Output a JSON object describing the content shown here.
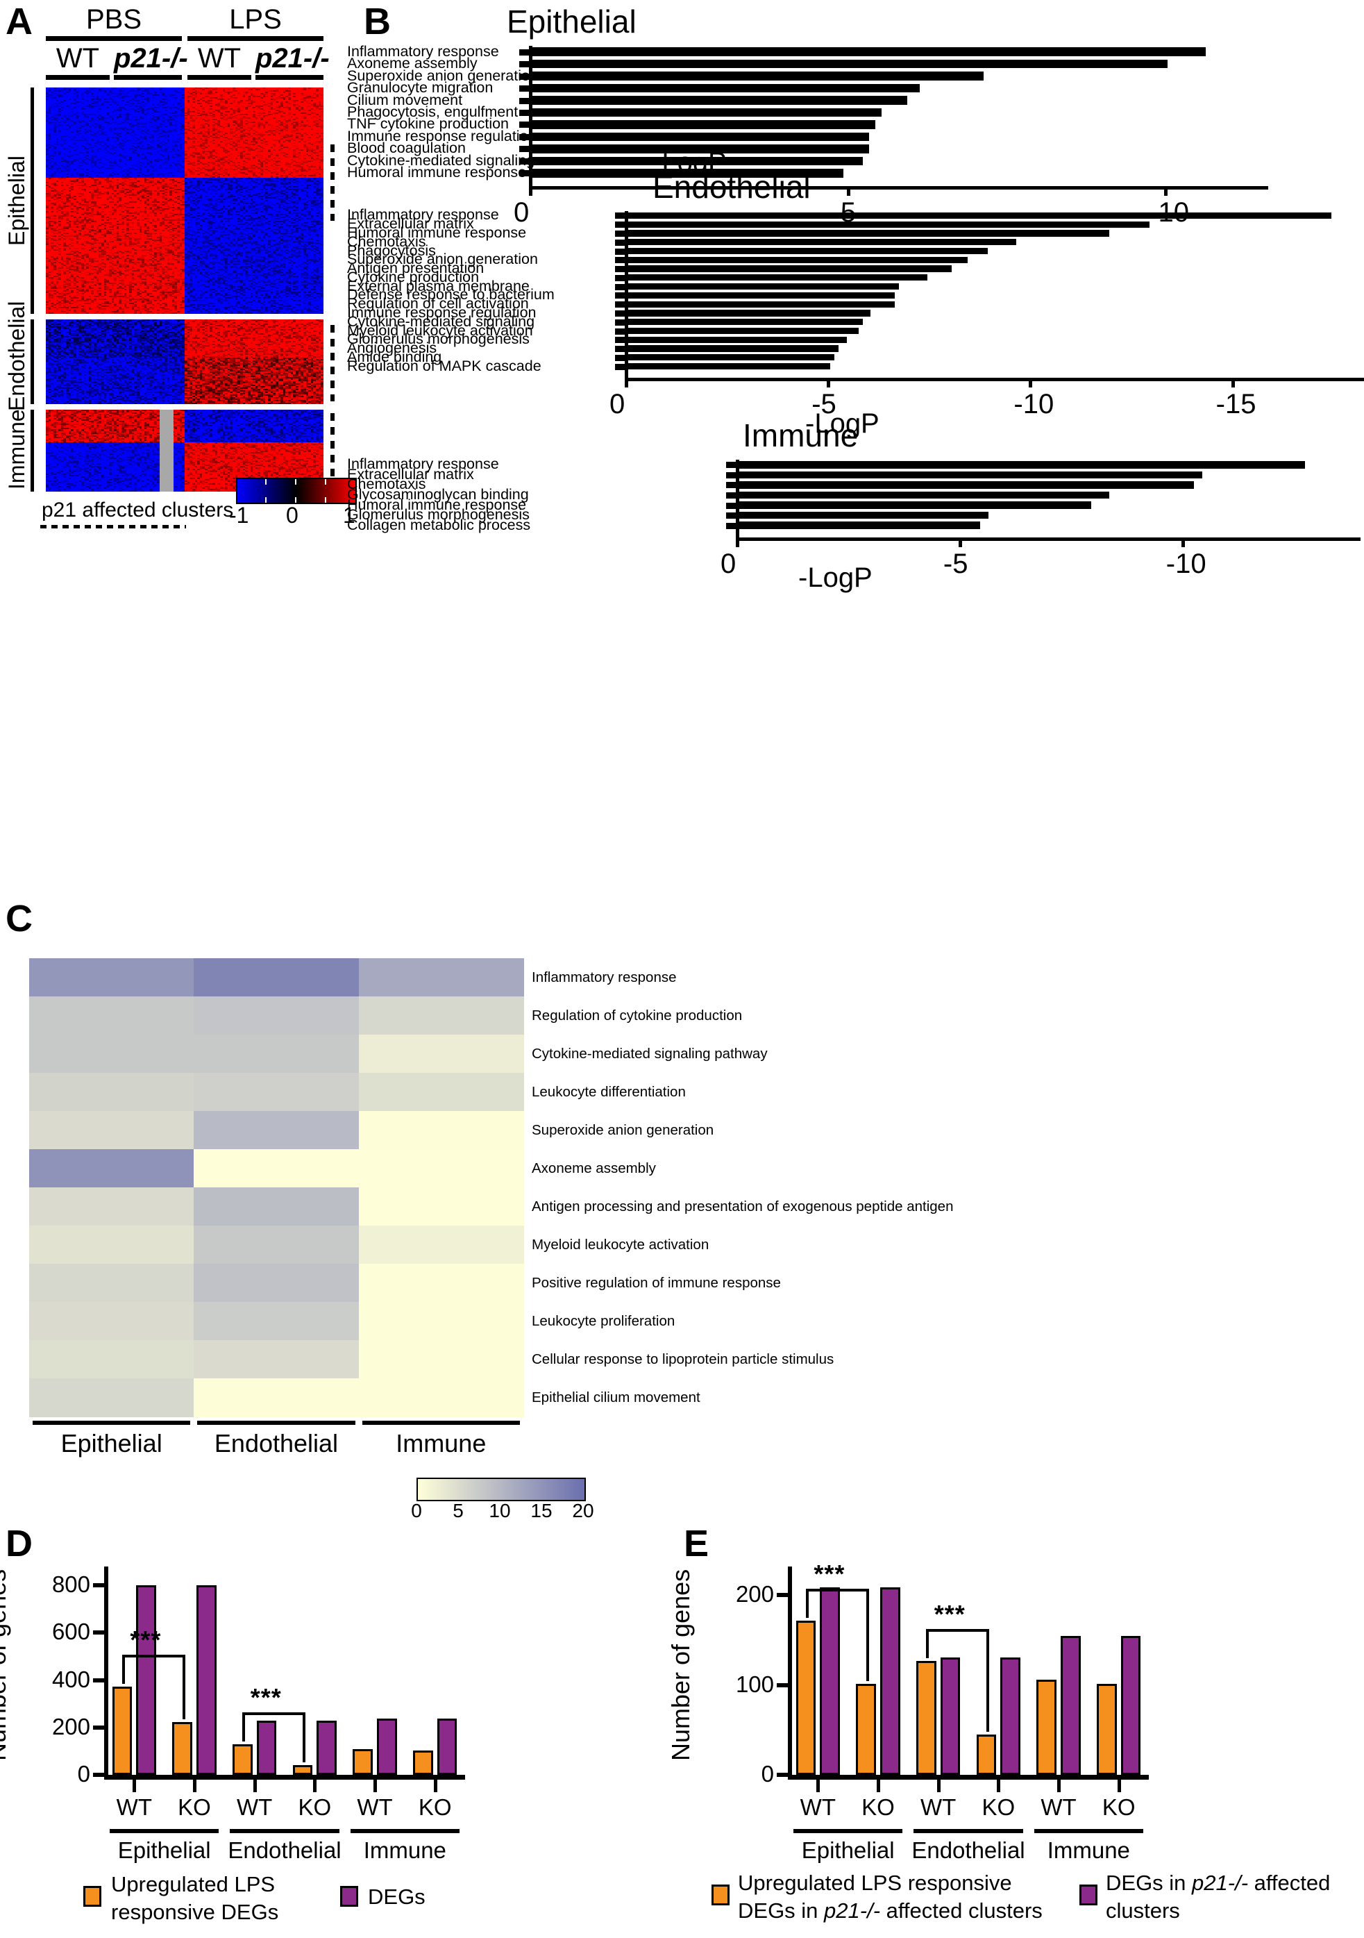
{
  "panels": {
    "A": {
      "letter": "A"
    },
    "B": {
      "letter": "B"
    },
    "C": {
      "letter": "C"
    },
    "D": {
      "letter": "D"
    },
    "E": {
      "letter": "E"
    }
  },
  "panelA": {
    "treatments": [
      "PBS",
      "LPS"
    ],
    "genotypes": [
      "WT",
      "p21-/-",
      "WT",
      "p21-/-"
    ],
    "row_groups": [
      "Epithelial",
      "Endothelial",
      "Immune"
    ],
    "cluster_note": "p21 affected clusters",
    "colorbar": {
      "min": "-1",
      "mid": "0",
      "max": "1",
      "low_color": "#0000FF",
      "mid_color": "#000000",
      "high_color": "#FF0000"
    }
  },
  "chart_data": [
    {
      "type": "bar",
      "title": "Epithelial",
      "xlabel": "-LogP",
      "orientation": "horizontal",
      "xlim": [
        0,
        -11.2
      ],
      "xticks": [
        0,
        -5,
        -10
      ],
      "xticklabels": [
        "0",
        "-5",
        "-10"
      ],
      "categories": [
        "Inflammatory response",
        "Axoneme assembly",
        "Superoxide anion generation",
        "Granulocyte migration",
        "Cilium movement",
        "Phagocytosis, engulfment",
        "TNF cytokine production",
        "Immune response regulation",
        "Blood coagulation",
        "Cytokine-mediated signaling",
        "Humoral immune response"
      ],
      "values": [
        -10.6,
        -10.0,
        -7.1,
        -6.1,
        -5.9,
        -5.5,
        -5.4,
        -5.3,
        -5.3,
        -5.2,
        -4.9
      ]
    },
    {
      "type": "bar",
      "title": "Endothelial",
      "xlabel": "-LogP",
      "orientation": "horizontal",
      "xlim": [
        0,
        -18.2
      ],
      "xticks": [
        0,
        -5,
        -10,
        -15
      ],
      "xticklabels": [
        "0",
        "-5",
        "-10",
        "-15"
      ],
      "categories": [
        "Inflammatory response",
        "Extracellular matrix",
        "Humoral immune response",
        "Chemotaxis",
        "Phagocytosis",
        "Superoxide anion generation",
        "Antigen presentation",
        "Cytokine production",
        "External plasma membrane",
        "Defense response to bacterium",
        "Regulation of cell activation",
        "Immune response regulation",
        "Cytokine-mediated signaling",
        "Myeloid leukocyte activation",
        "Glomerulus morphogenesis",
        "Angiogenesis",
        "Amide binding",
        "Regulation of MAPK cascade"
      ],
      "values": [
        -17.4,
        -12.9,
        -11.9,
        -9.6,
        -8.9,
        -8.4,
        -8.0,
        -7.4,
        -6.7,
        -6.6,
        -6.6,
        -6.0,
        -5.8,
        -5.7,
        -5.4,
        -5.2,
        -5.1,
        -5.0
      ]
    },
    {
      "type": "bar",
      "title": "Immune",
      "xlabel": "-LogP",
      "orientation": "horizontal",
      "xlim": [
        0,
        -13.4
      ],
      "xticks": [
        0,
        -5,
        -10
      ],
      "xticklabels": [
        "0",
        "-5",
        "-10"
      ],
      "categories": [
        "Inflammatory response",
        "Extracellular matrix",
        "Chemotaxis",
        "Glycosaminoglycan binding",
        "Humoral immune response",
        "Glomerulus morphogenesis",
        "Collagen metabolic process"
      ],
      "values": [
        -12.7,
        -10.4,
        -10.2,
        -8.3,
        -7.9,
        -5.6,
        -5.4
      ]
    },
    {
      "type": "heatmap",
      "title": "",
      "columns": [
        "Epithelial",
        "Endothelial",
        "Immune"
      ],
      "rows": [
        "Inflammatory response",
        "Regulation of cytokine production",
        "Cytokine-mediated signaling pathway",
        "Leukocyte differentiation",
        "Superoxide anion generation",
        "Axoneme assembly",
        "Antigen processing and presentation of exogenous peptide antigen",
        "Myeloid leukocyte activation",
        "Positive regulation of immune response",
        "Leukocyte proliferation",
        "Cellular response to lipoprotein particle stimulus",
        "Epithelial cilium movement"
      ],
      "values": [
        [
          14.5,
          17.0,
          12.0
        ],
        [
          7.5,
          8.0,
          5.5
        ],
        [
          7.5,
          7.5,
          2.5
        ],
        [
          6.0,
          6.5,
          4.5
        ],
        [
          5.0,
          9.5,
          0.3
        ],
        [
          15.0,
          0.2,
          0.2
        ],
        [
          5.0,
          9.0,
          0.2
        ],
        [
          4.0,
          7.5,
          2.0
        ],
        [
          5.5,
          8.5,
          0.3
        ],
        [
          5.0,
          7.0,
          0.3
        ],
        [
          4.5,
          5.0,
          0.3
        ],
        [
          5.5,
          0.3,
          0.3
        ]
      ],
      "colorbar": {
        "ticks": [
          "0",
          "5",
          "10",
          "15",
          "20"
        ],
        "low_color": "#FFFFD9",
        "high_color": "#6A6FAE"
      }
    },
    {
      "type": "bar",
      "panel": "D",
      "ylabel": "Number of genes",
      "ylim": [
        0,
        880
      ],
      "yticks": [
        0,
        200,
        400,
        600,
        800
      ],
      "yticklabels": [
        "0",
        "200",
        "400",
        "600",
        "800"
      ],
      "groups": [
        "Epithelial",
        "Endothelial",
        "Immune"
      ],
      "categories": [
        "WT",
        "KO",
        "WT",
        "KO",
        "WT",
        "KO"
      ],
      "series": [
        {
          "name": "Upregulated LPS responsive DEGs",
          "color": "#F5901E",
          "values": [
            373,
            222,
            128,
            42,
            108,
            103
          ]
        },
        {
          "name": "DEGs",
          "color": "#8B2A8B",
          "values": [
            800,
            800,
            228,
            228,
            238,
            238
          ]
        }
      ],
      "significance": [
        "***",
        "***"
      ],
      "legend": [
        {
          "label": "Upregulated LPS responsive DEGs",
          "color": "#F5901E"
        },
        {
          "label": "DEGs",
          "color": "#8B2A8B"
        }
      ]
    },
    {
      "type": "bar",
      "panel": "E",
      "ylabel": "Number of genes",
      "ylim": [
        0,
        232
      ],
      "yticks": [
        0,
        100,
        200
      ],
      "yticklabels": [
        "0",
        "100",
        "200"
      ],
      "groups": [
        "Epithelial",
        "Endothelial",
        "Immune"
      ],
      "categories": [
        "WT",
        "KO",
        "WT",
        "KO",
        "WT",
        "KO"
      ],
      "series": [
        {
          "name": "Upregulated LPS responsive DEGs in p21-/- affected clusters",
          "color": "#F5901E",
          "values": [
            172,
            101,
            127,
            45,
            106,
            101
          ]
        },
        {
          "name": "DEGs in p21-/- affected clusters",
          "color": "#8B2A8B",
          "values": [
            209,
            209,
            131,
            131,
            155,
            155
          ]
        }
      ],
      "significance": [
        "***",
        "***"
      ],
      "legend": [
        {
          "label_line1": "Upregulated LPS responsive",
          "label_line2_pre": "DEGs in ",
          "label_line2_ital": "p21-/-",
          "label_line2_post": " affected clusters",
          "color": "#F5901E"
        },
        {
          "label_line1_pre": "DEGs in ",
          "label_line1_ital": "p21-/-",
          "label_line1_post": " affected",
          "label_line2": "clusters",
          "color": "#8B2A8B"
        }
      ]
    }
  ],
  "panelD_legend": {
    "s1_line1": "Upregulated LPS",
    "s1_line2": "responsive DEGs",
    "s2_line1": "DEGs"
  },
  "panelE_legend": {
    "s1_line1": "Upregulated LPS responsive",
    "s1_line2_pre": "DEGs in ",
    "s1_line2_ital": "p21-/-",
    "s1_line2_post": " affected clusters",
    "s2_line1_pre": "DEGs in ",
    "s2_line1_ital": "p21-/-",
    "s2_line1_post": " affected",
    "s2_line2": "clusters"
  }
}
